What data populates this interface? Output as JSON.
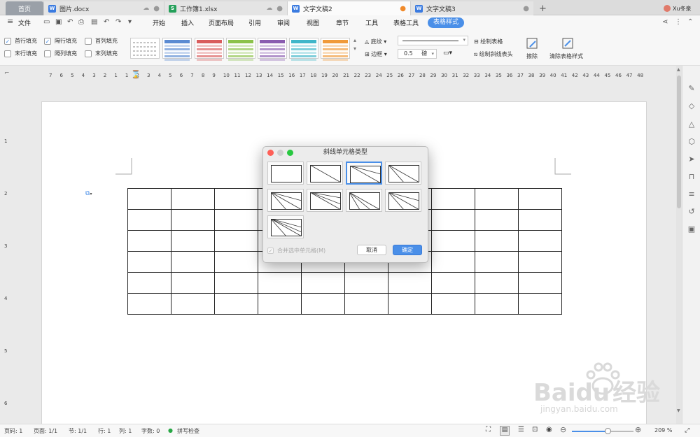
{
  "tabs": [
    {
      "label": "首页",
      "type": "home"
    },
    {
      "label": "图片.docx",
      "icon": "W"
    },
    {
      "label": "工作簿1.xlsx",
      "icon": "S"
    },
    {
      "label": "文字文稿2",
      "icon": "W"
    },
    {
      "label": "文字文稿3",
      "icon": "W"
    }
  ],
  "new_tab": "+",
  "user": "Xu冬泉",
  "menu": {
    "file": "文件",
    "items": [
      "开始",
      "插入",
      "页面布局",
      "引用",
      "审阅",
      "视图",
      "章节",
      "工具",
      "表格工具"
    ],
    "active": "表格样式"
  },
  "ribbon": {
    "checkboxes": [
      {
        "label": "首行填充",
        "checked": true
      },
      {
        "label": "隔行填充",
        "checked": true
      },
      {
        "label": "首列填充",
        "checked": false
      },
      {
        "label": "末行填充",
        "checked": false
      },
      {
        "label": "隔列填充",
        "checked": false
      },
      {
        "label": "末列填充",
        "checked": false
      }
    ],
    "swatch_colors": [
      "#5b8bd2",
      "#d95d5d",
      "#8bc24a",
      "#8a5db0",
      "#3fb6c9",
      "#f09a3a"
    ],
    "shading": "底纹",
    "border": "边框",
    "line_width": "0.5",
    "line_unit": "磅",
    "draw_table": "绘制表格",
    "draw_slash_header": "绘制斜线表头",
    "erase": "擦除",
    "clear_style": "清除表格样式"
  },
  "ruler": {
    "labels": [
      "7",
      "6",
      "5",
      "4",
      "3",
      "2",
      "1",
      "1",
      "2",
      "3",
      "4",
      "5",
      "6",
      "7",
      "8",
      "9",
      "10",
      "11",
      "12",
      "13",
      "14",
      "15",
      "16",
      "17",
      "18",
      "19",
      "20",
      "21",
      "22",
      "23",
      "24",
      "25",
      "26",
      "27",
      "28",
      "29",
      "30",
      "31",
      "32",
      "33",
      "34",
      "35",
      "36",
      "37",
      "38",
      "39",
      "40",
      "41",
      "42",
      "43",
      "44",
      "45",
      "46",
      "47",
      "48"
    ]
  },
  "vruler_labels": [
    "1",
    "2",
    "3",
    "4",
    "5",
    "6"
  ],
  "table": {
    "rows": 6,
    "cols": 10
  },
  "dialog": {
    "title": "斜线单元格类型",
    "merge_label": "合并选中单元格(M)",
    "merge_checked": true,
    "merge_disabled": true,
    "cancel": "取消",
    "ok": "确定",
    "selected_option": 2,
    "option_count": 9
  },
  "status": {
    "page_code": "页码: 1",
    "pages": "页面: 1/1",
    "section": "节: 1/1",
    "row": "行: 1",
    "col": "列: 1",
    "word_count": "字数: 0",
    "spell": "拼写检查",
    "zoom": "209 %",
    "zoom_level": 0.58
  },
  "watermark": {
    "brand": "Baidu",
    "brand2": "经验",
    "url": "jingyan.baidu.com"
  }
}
